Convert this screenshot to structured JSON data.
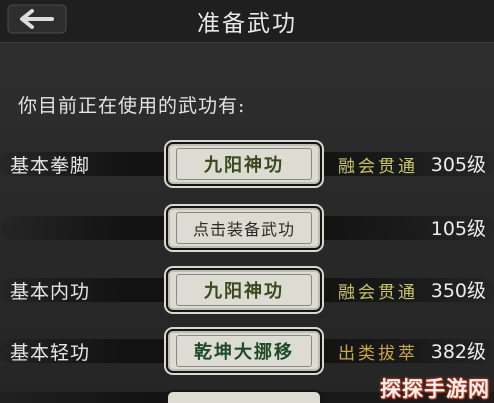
{
  "header": {
    "title": "准备武功",
    "back_icon": "back-arrow-icon"
  },
  "intro_text": "你目前正在使用的武功有:",
  "rows": [
    {
      "label": "基本拳脚",
      "skill": "九阳神功",
      "skill_color": "#3b4a1e",
      "grade": "融会贯通",
      "grade_color": "#c9c56a",
      "level": "305级",
      "empty": false
    },
    {
      "label": "",
      "skill": "点击装备武功",
      "skill_color": "#2a2a2a",
      "grade": "",
      "grade_color": "#c9c56a",
      "level": "105级",
      "empty": true
    },
    {
      "label": "基本内功",
      "skill": "九阳神功",
      "skill_color": "#3b4a1e",
      "grade": "融会贯通",
      "grade_color": "#c9c56a",
      "level": "350级",
      "empty": false
    },
    {
      "label": "基本轻功",
      "skill": "乾坤大挪移",
      "skill_color": "#1e4a2a",
      "grade": "出类拔萃",
      "grade_color": "#c9a84a",
      "level": "382级",
      "empty": false
    }
  ],
  "watermark": "探探手游网",
  "colors": {
    "background": "#2a2a2a",
    "header": "#1f1f1f",
    "button_face": "#dcdcd2"
  }
}
